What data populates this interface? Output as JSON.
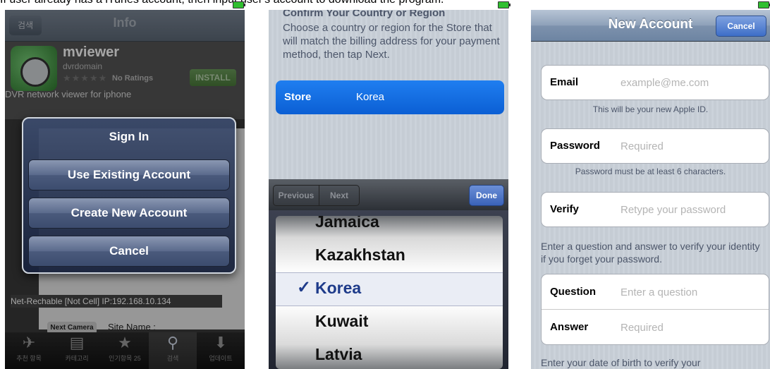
{
  "caption": "If user already has a iTunes account, then input user's account to download the program.",
  "screen1": {
    "nav": {
      "back": "검색",
      "title": "Info"
    },
    "app": {
      "name": "mviewer",
      "developer": "dvrdomain",
      "ratings": "No Ratings",
      "install": "INSTALL",
      "stars": "★★★★★"
    },
    "description": "DVR network viewer for iphone",
    "status_line": "Net-Rechable [Not Cell] IP:192.168.10.134",
    "next_camera": "Next Camera",
    "site_name": "Site Name :",
    "dialog": {
      "title": "Sign In",
      "buttons": [
        "Use Existing Account",
        "Create New Account",
        "Cancel"
      ]
    },
    "tabs": [
      {
        "icon": "✈",
        "label": "추천 항목"
      },
      {
        "icon": "▤",
        "label": "카테고리"
      },
      {
        "icon": "★",
        "label": "인기항목 25"
      },
      {
        "icon": "⚲",
        "label": "검색"
      },
      {
        "icon": "⬇",
        "label": "업데이트"
      }
    ]
  },
  "screen2": {
    "heading": "Confirm Your Country or Region",
    "instructions": "Choose a country or region for the Store that will match the billing address for your payment method, then tap Next.",
    "store": {
      "label": "Store",
      "value": "Korea"
    },
    "toolbar": {
      "previous": "Previous",
      "next": "Next",
      "done": "Done"
    },
    "picker": {
      "options": [
        "Jamaica",
        "Kazakhstan",
        "Korea",
        "Kuwait",
        "Latvia"
      ],
      "selected": "Korea",
      "check": "✓"
    }
  },
  "screen3": {
    "nav": {
      "title": "New Account",
      "cancel": "Cancel"
    },
    "email": {
      "label": "Email",
      "placeholder": "example@me.com",
      "note": "This will be your new Apple ID."
    },
    "password": {
      "label": "Password",
      "placeholder": "Required",
      "note": "Password must be at least 6 characters."
    },
    "verify": {
      "label": "Verify",
      "placeholder": "Retype your password"
    },
    "question_intro": "Enter a question and answer to verify your identity if you forget your password.",
    "question": {
      "label": "Question",
      "placeholder": "Enter a question"
    },
    "answer": {
      "label": "Answer",
      "placeholder": "Required"
    },
    "birth_intro": "Enter your date of birth to verify your"
  }
}
